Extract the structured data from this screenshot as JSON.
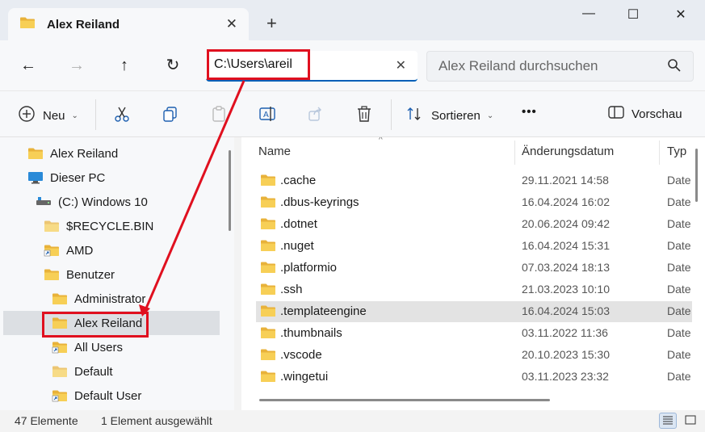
{
  "tab": {
    "title": "Alex Reiland",
    "close": "✕",
    "new_tab": "+"
  },
  "window": {
    "minimize": "—",
    "maximize": "☐",
    "close": "✕"
  },
  "nav": {
    "back": "←",
    "forward": "→",
    "up": "↑",
    "refresh": "↻"
  },
  "address": {
    "value": "C:\\Users\\areil",
    "clear": "✕"
  },
  "search": {
    "placeholder": "Alex Reiland durchsuchen"
  },
  "toolbar": {
    "new_label": "Neu",
    "sort_label": "Sortieren",
    "more": "•••",
    "preview_label": "Vorschau"
  },
  "sidebar": {
    "items": [
      {
        "label": "Alex Reiland",
        "icon": "folder-icon"
      },
      {
        "label": "Dieser PC",
        "icon": "pc-icon"
      },
      {
        "label": "(C:) Windows 10",
        "icon": "drive-icon"
      },
      {
        "label": "$RECYCLE.BIN",
        "icon": "folder-icon"
      },
      {
        "label": "AMD",
        "icon": "folder-shortcut-icon"
      },
      {
        "label": "Benutzer",
        "icon": "folder-icon"
      },
      {
        "label": "Administrator",
        "icon": "folder-icon"
      },
      {
        "label": "Alex Reiland",
        "icon": "folder-icon"
      },
      {
        "label": "All Users",
        "icon": "folder-shortcut-icon"
      },
      {
        "label": "Default",
        "icon": "folder-icon"
      },
      {
        "label": "Default User",
        "icon": "folder-shortcut-icon"
      }
    ]
  },
  "list": {
    "columns": {
      "name": "Name",
      "date": "Änderungsdatum",
      "type": "Typ"
    },
    "rows": [
      {
        "name": ".cache",
        "date": "29.11.2021 14:58",
        "type": "Date"
      },
      {
        "name": ".dbus-keyrings",
        "date": "16.04.2024 16:02",
        "type": "Date"
      },
      {
        "name": ".dotnet",
        "date": "20.06.2024 09:42",
        "type": "Date"
      },
      {
        "name": ".nuget",
        "date": "16.04.2024 15:31",
        "type": "Date"
      },
      {
        "name": ".platformio",
        "date": "07.03.2024 18:13",
        "type": "Date"
      },
      {
        "name": ".ssh",
        "date": "21.03.2023 10:10",
        "type": "Date"
      },
      {
        "name": ".templateengine",
        "date": "16.04.2024 15:03",
        "type": "Date"
      },
      {
        "name": ".thumbnails",
        "date": "03.11.2022 11:36",
        "type": "Date"
      },
      {
        "name": ".vscode",
        "date": "20.10.2023 15:30",
        "type": "Date"
      },
      {
        "name": ".wingetui",
        "date": "03.11.2023 23:32",
        "type": "Date"
      }
    ]
  },
  "status": {
    "count": "47 Elemente",
    "selection": "1 Element ausgewählt"
  },
  "colors": {
    "accent": "#005fb8",
    "annotation": "#e0101f",
    "folder": "#f4c84a"
  }
}
